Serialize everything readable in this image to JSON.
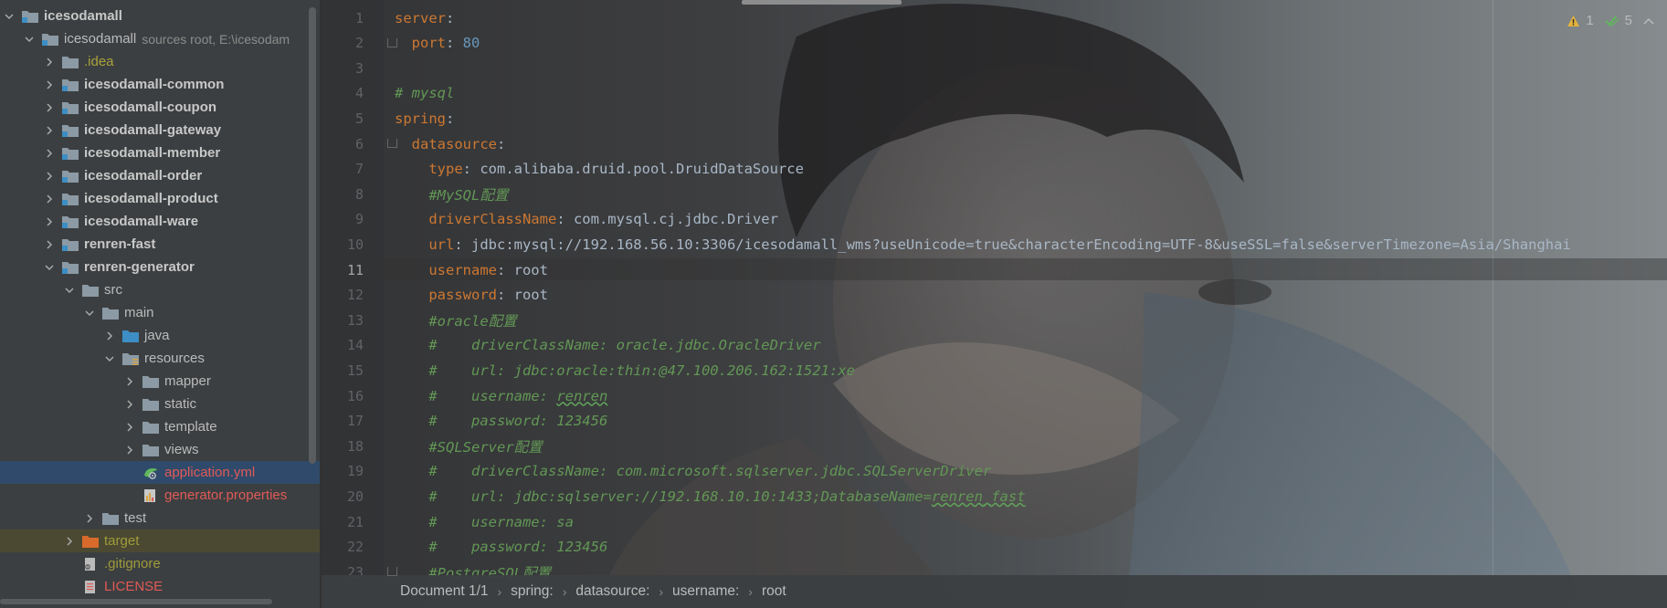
{
  "project_tree": {
    "items": [
      {
        "label": "icesodamall",
        "depth": 0,
        "expanded": true,
        "icon": "module-folder-icon",
        "style": "bold",
        "color": "default"
      },
      {
        "label": "icesodamall",
        "depth": 1,
        "expanded": true,
        "icon": "module-folder-icon",
        "style": "normal",
        "color": "default",
        "hint": "sources root,  E:\\icesodam"
      },
      {
        "label": ".idea",
        "depth": 2,
        "expanded": false,
        "icon": "folder-icon",
        "style": "normal",
        "color": "yellow"
      },
      {
        "label": "icesodamall-common",
        "depth": 2,
        "expanded": false,
        "icon": "module-folder-icon",
        "style": "bold",
        "color": "default"
      },
      {
        "label": "icesodamall-coupon",
        "depth": 2,
        "expanded": false,
        "icon": "module-folder-icon",
        "style": "bold",
        "color": "default"
      },
      {
        "label": "icesodamall-gateway",
        "depth": 2,
        "expanded": false,
        "icon": "module-folder-icon",
        "style": "bold",
        "color": "default"
      },
      {
        "label": "icesodamall-member",
        "depth": 2,
        "expanded": false,
        "icon": "module-folder-icon",
        "style": "bold",
        "color": "default"
      },
      {
        "label": "icesodamall-order",
        "depth": 2,
        "expanded": false,
        "icon": "module-folder-icon",
        "style": "bold",
        "color": "default"
      },
      {
        "label": "icesodamall-product",
        "depth": 2,
        "expanded": false,
        "icon": "module-folder-icon",
        "style": "bold",
        "color": "default"
      },
      {
        "label": "icesodamall-ware",
        "depth": 2,
        "expanded": false,
        "icon": "module-folder-icon",
        "style": "bold",
        "color": "default"
      },
      {
        "label": "renren-fast",
        "depth": 2,
        "expanded": false,
        "icon": "module-folder-icon",
        "style": "bold",
        "color": "default"
      },
      {
        "label": "renren-generator",
        "depth": 2,
        "expanded": true,
        "icon": "module-folder-icon",
        "style": "bold",
        "color": "default"
      },
      {
        "label": "src",
        "depth": 3,
        "expanded": true,
        "icon": "folder-icon",
        "style": "normal",
        "color": "default"
      },
      {
        "label": "main",
        "depth": 4,
        "expanded": true,
        "icon": "folder-icon",
        "style": "normal",
        "color": "default"
      },
      {
        "label": "java",
        "depth": 5,
        "expanded": false,
        "icon": "source-folder-icon",
        "style": "normal",
        "color": "default"
      },
      {
        "label": "resources",
        "depth": 5,
        "expanded": true,
        "icon": "resources-folder-icon",
        "style": "normal",
        "color": "default"
      },
      {
        "label": "mapper",
        "depth": 6,
        "expanded": false,
        "icon": "folder-icon",
        "style": "normal",
        "color": "default"
      },
      {
        "label": "static",
        "depth": 6,
        "expanded": false,
        "icon": "folder-icon",
        "style": "normal",
        "color": "default"
      },
      {
        "label": "template",
        "depth": 6,
        "expanded": false,
        "icon": "folder-icon",
        "style": "normal",
        "color": "default"
      },
      {
        "label": "views",
        "depth": 6,
        "expanded": false,
        "icon": "folder-icon",
        "style": "normal",
        "color": "default"
      },
      {
        "label": "application.yml",
        "depth": 6,
        "leaf": true,
        "icon": "yaml-settings-icon",
        "style": "normal",
        "color": "red",
        "selected": true
      },
      {
        "label": "generator.properties",
        "depth": 6,
        "leaf": true,
        "icon": "properties-file-icon",
        "style": "normal",
        "color": "red"
      },
      {
        "label": "test",
        "depth": 4,
        "expanded": false,
        "icon": "folder-icon",
        "style": "normal",
        "color": "default"
      },
      {
        "label": "target",
        "depth": 3,
        "expanded": false,
        "icon": "excluded-folder-icon",
        "style": "normal",
        "color": "olive",
        "excluded": true
      },
      {
        "label": ".gitignore",
        "depth": 3,
        "leaf": true,
        "icon": "gitignore-file-icon",
        "style": "normal",
        "color": "olive"
      },
      {
        "label": "LICENSE",
        "depth": 3,
        "leaf": true,
        "icon": "text-file-icon",
        "style": "normal",
        "color": "red"
      }
    ]
  },
  "editor": {
    "current_line": 11,
    "inspections": {
      "warnings": "1",
      "ok": "5"
    },
    "lines": [
      {
        "n": "1",
        "t": [
          [
            "k",
            "server"
          ],
          [
            "v",
            ":"
          ]
        ]
      },
      {
        "n": "2",
        "t": [
          [
            "v",
            "  "
          ],
          [
            "k",
            "port"
          ],
          [
            "v",
            ": "
          ],
          [
            "n",
            "80"
          ]
        ]
      },
      {
        "n": "3",
        "t": []
      },
      {
        "n": "4",
        "t": [
          [
            "cm",
            "# mysql"
          ]
        ]
      },
      {
        "n": "5",
        "t": [
          [
            "k",
            "spring"
          ],
          [
            "v",
            ":"
          ]
        ]
      },
      {
        "n": "6",
        "t": [
          [
            "v",
            "  "
          ],
          [
            "k",
            "datasource"
          ],
          [
            "v",
            ":"
          ]
        ]
      },
      {
        "n": "7",
        "t": [
          [
            "v",
            "    "
          ],
          [
            "k",
            "type"
          ],
          [
            "v",
            ": com.alibaba.druid.pool.DruidDataSource"
          ]
        ]
      },
      {
        "n": "8",
        "t": [
          [
            "v",
            "    "
          ],
          [
            "cm",
            "#MySQL配置"
          ]
        ]
      },
      {
        "n": "9",
        "t": [
          [
            "v",
            "    "
          ],
          [
            "k",
            "driverClassName"
          ],
          [
            "v",
            ": com.mysql.cj.jdbc.Driver"
          ]
        ]
      },
      {
        "n": "10",
        "t": [
          [
            "v",
            "    "
          ],
          [
            "k",
            "url"
          ],
          [
            "v",
            ": jdbc:mysql://192.168.56.10:3306/icesodamall_wms?useUnicode=true&characterEncoding=UTF-8&useSSL=false&serverTimezone=Asia/Shanghai"
          ]
        ]
      },
      {
        "n": "11",
        "t": [
          [
            "v",
            "    "
          ],
          [
            "k",
            "username"
          ],
          [
            "v",
            ": root"
          ]
        ]
      },
      {
        "n": "12",
        "t": [
          [
            "v",
            "    "
          ],
          [
            "k",
            "password"
          ],
          [
            "v",
            ": root"
          ]
        ]
      },
      {
        "n": "13",
        "t": [
          [
            "v",
            "    "
          ],
          [
            "cm",
            "#oracle配置"
          ]
        ]
      },
      {
        "n": "14",
        "t": [
          [
            "v",
            "    "
          ],
          [
            "cm",
            "#    driverClassName: oracle.jdbc.OracleDriver"
          ]
        ]
      },
      {
        "n": "15",
        "t": [
          [
            "v",
            "    "
          ],
          [
            "cm",
            "#    url: jdbc:oracle:thin:@47.100.206.162:1521:xe"
          ]
        ]
      },
      {
        "n": "16",
        "t": [
          [
            "v",
            "    "
          ],
          [
            "cm",
            "#    username: "
          ],
          [
            "cmsq",
            "renren"
          ]
        ]
      },
      {
        "n": "17",
        "t": [
          [
            "v",
            "    "
          ],
          [
            "cm",
            "#    password: 123456"
          ]
        ]
      },
      {
        "n": "18",
        "t": [
          [
            "v",
            "    "
          ],
          [
            "cm",
            "#SQLServer配置"
          ]
        ]
      },
      {
        "n": "19",
        "t": [
          [
            "v",
            "    "
          ],
          [
            "cm",
            "#    driverClassName: com.microsoft.sqlserver.jdbc.SQLServerDriver"
          ]
        ]
      },
      {
        "n": "20",
        "t": [
          [
            "v",
            "    "
          ],
          [
            "cm",
            "#    url: jdbc:sqlserver://192.168.10.10:1433;DatabaseName="
          ],
          [
            "cmsq",
            "renren_fast"
          ]
        ]
      },
      {
        "n": "21",
        "t": [
          [
            "v",
            "    "
          ],
          [
            "cm",
            "#    username: sa"
          ]
        ]
      },
      {
        "n": "22",
        "t": [
          [
            "v",
            "    "
          ],
          [
            "cm",
            "#    password: 123456"
          ]
        ]
      },
      {
        "n": "23",
        "t": [
          [
            "v",
            "    "
          ],
          [
            "cm",
            "#PostgreSQL配置"
          ]
        ]
      }
    ]
  },
  "breadcrumb": {
    "items": [
      "Document 1/1",
      "spring:",
      "datasource:",
      "username:",
      "root"
    ]
  },
  "colors": {
    "keyword": "#cc7832",
    "value": "#a9b7c6",
    "number": "#6897bb",
    "comment": "#629755",
    "selection": "#2f4a6a",
    "tree_bg": "#3c3f41"
  }
}
